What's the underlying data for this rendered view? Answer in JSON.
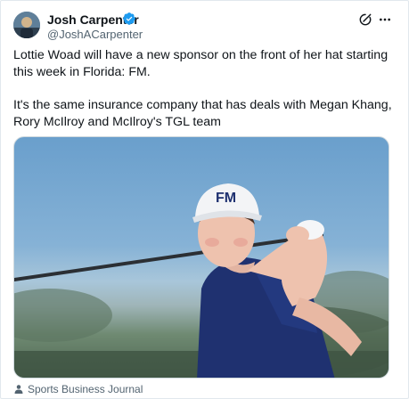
{
  "post": {
    "author_name": "Josh Carpenter",
    "author_handle": "@JoshACarpenter",
    "paragraph_1": "Lottie Woad will have a new sponsor on the front of her hat starting this week in Florida: FM.",
    "paragraph_2": "It's the same insurance company that has deals with Megan Khang, Rory McIlroy and McIlroy's TGL team"
  },
  "media": {
    "hat_logo": "FM",
    "source_label": "Sports Business Journal"
  },
  "icons": {
    "verified": "verified-badge-icon",
    "grok": "grok-icon",
    "more": "more-options-icon",
    "source": "person-icon"
  },
  "colors": {
    "verified_blue": "#1d9bf0",
    "secondary_text": "#536471",
    "primary_text": "#0f1419"
  }
}
